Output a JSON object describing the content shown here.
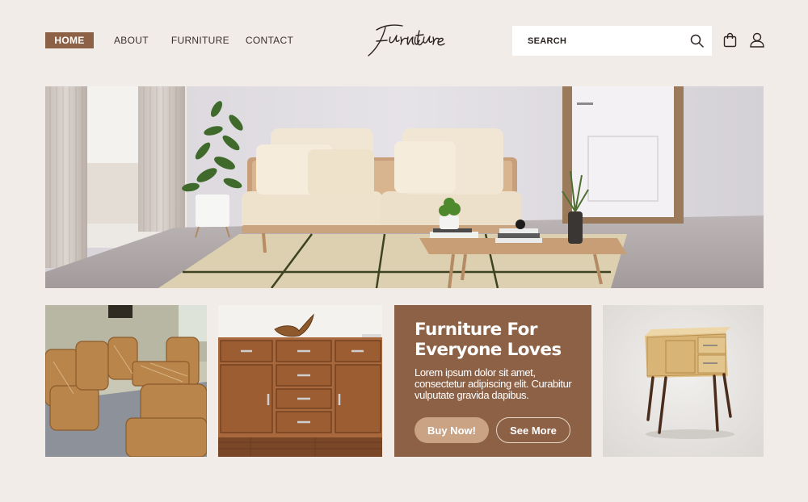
{
  "nav": {
    "items": [
      {
        "label": "HOME",
        "active": true
      },
      {
        "label": "ABOUT"
      },
      {
        "label": "FURNITURE"
      },
      {
        "label": "CONTACT"
      }
    ]
  },
  "brand": {
    "logo_text": "Furniture"
  },
  "search": {
    "placeholder": "SEARCH"
  },
  "icons": {
    "search": "search-icon",
    "bag": "shopping-bag-icon",
    "user": "user-icon"
  },
  "promo": {
    "title": "Furniture For\nEveryone Loves",
    "text": "Lorem ipsum dolor sit amet, consectetur adipiscing elit. Curabitur vulputate gravida dapibus.",
    "buy_label": "Buy Now!",
    "more_label": "See More"
  },
  "colors": {
    "accent": "#8c6146",
    "background": "#f1ece8",
    "button_fill": "#c9a384"
  }
}
